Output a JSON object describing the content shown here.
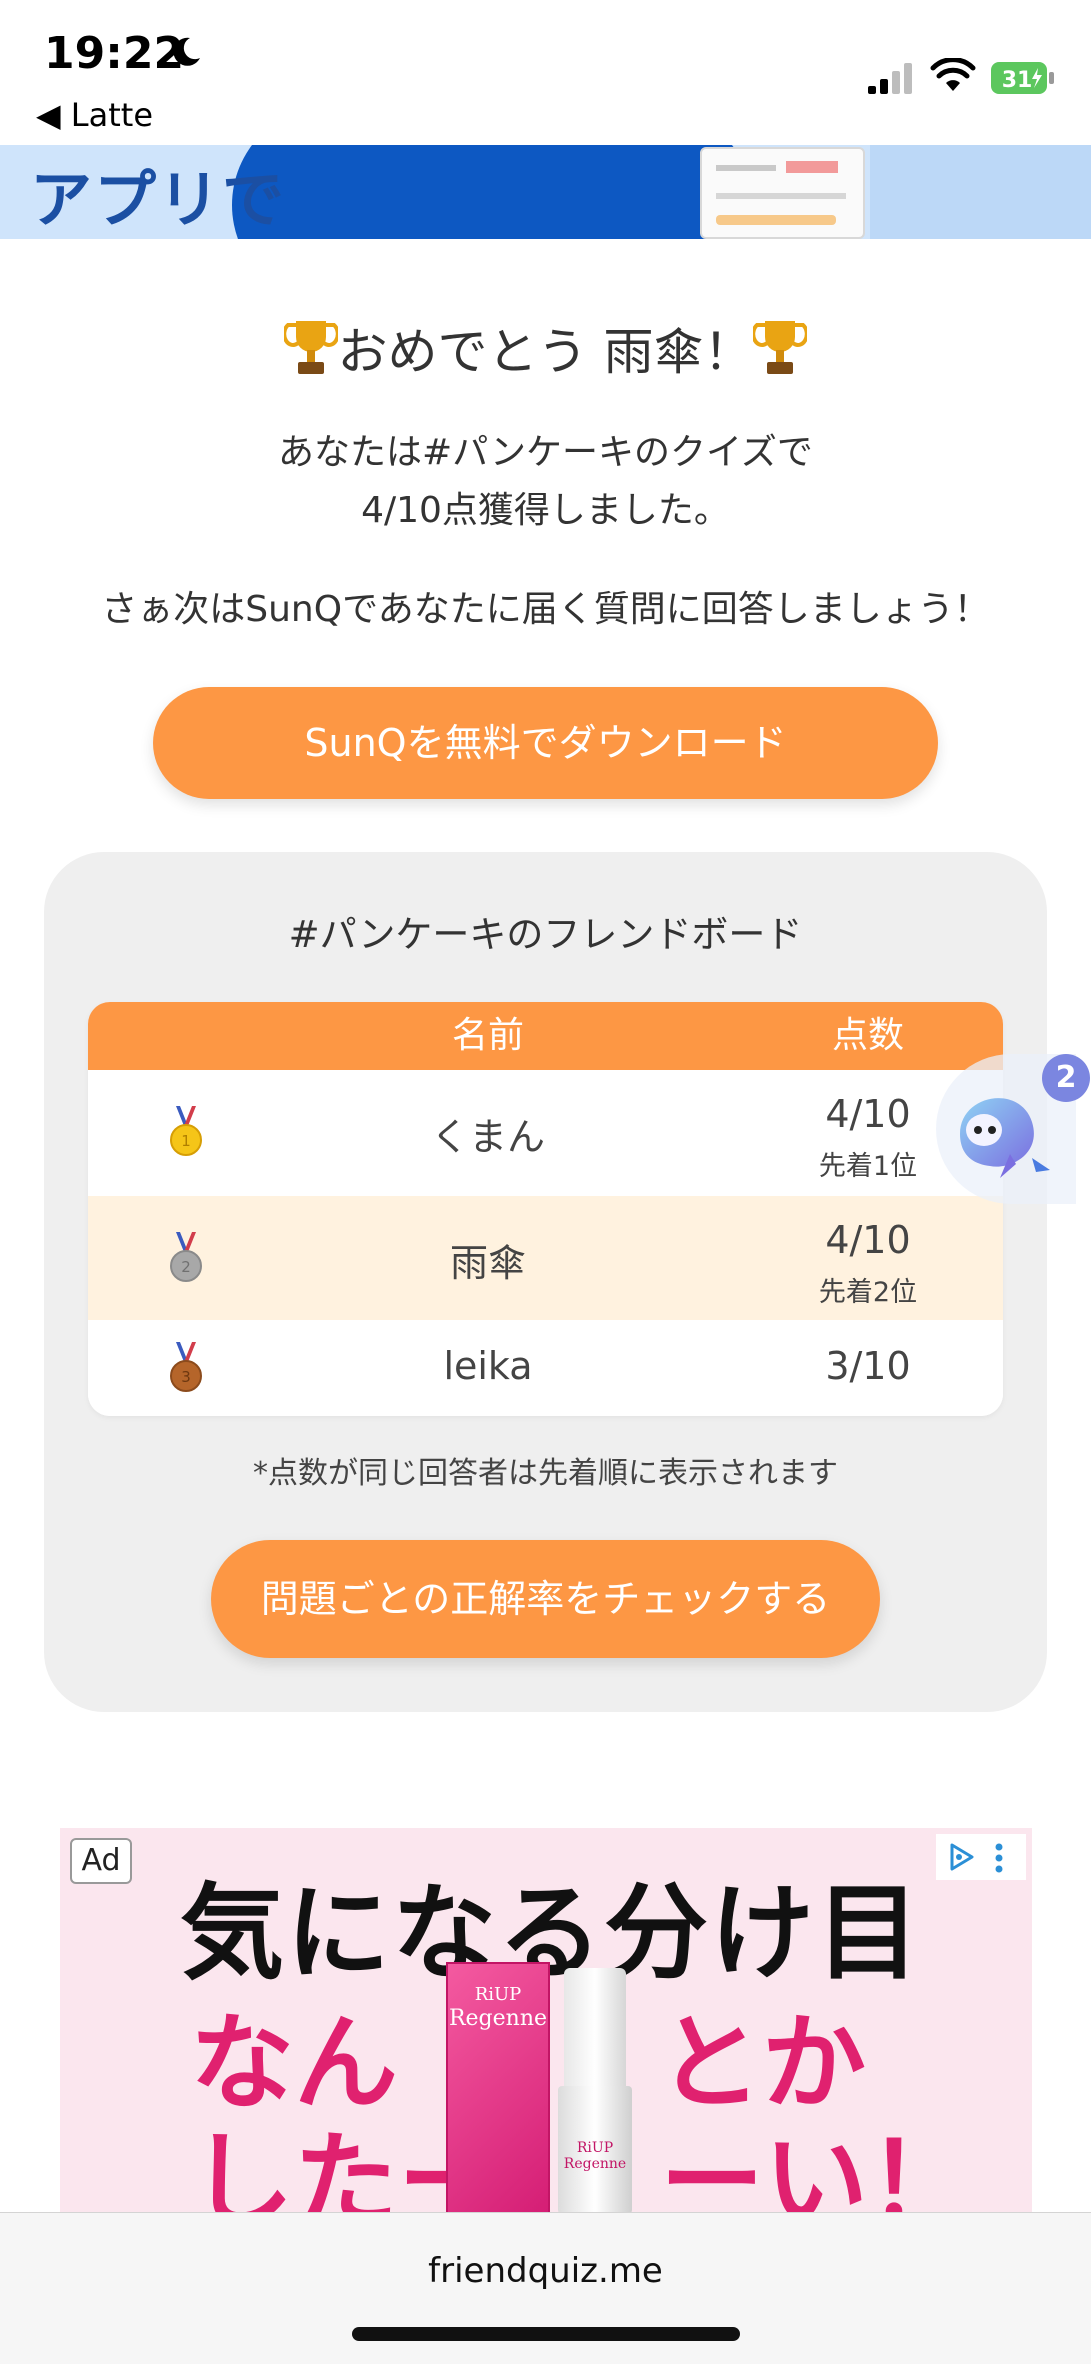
{
  "status_bar": {
    "time": "19:22",
    "back_app": "◀ Latte",
    "battery": "31"
  },
  "banner": {
    "text": "アプリで"
  },
  "congrats": {
    "title": "おめでとう 雨傘！",
    "result_line1": "あなたは#パンケーキのクイズで",
    "result_line2": "4/10点獲得しました。",
    "next_text": "さぁ次はSunQであなたに届く質問に回答しましょう！",
    "download_button": "SunQを無料でダウンロード"
  },
  "board": {
    "title": "#パンケーキのフレンドボード",
    "columns": [
      "名前",
      "点数"
    ],
    "rows": [
      {
        "rank": 1,
        "name": "くまん",
        "score": "4/10",
        "sub": "先着1位",
        "medal_color": "#f5c518"
      },
      {
        "rank": 2,
        "name": "雨傘",
        "score": "4/10",
        "sub": "先着2位",
        "medal_color": "#a8a8a8"
      },
      {
        "rank": 3,
        "name": "leika",
        "score": "3/10",
        "sub": "",
        "medal_color": "#b5652a"
      }
    ],
    "note": "*点数が同じ回答者は先着順に表示されます",
    "check_button": "問題ごとの正解率をチェックする"
  },
  "mascot": {
    "badge_count": "2"
  },
  "ad": {
    "label": "Ad",
    "line1": "気になる分け目",
    "line2a": "なん",
    "line2b": "とか",
    "line3a": "したー",
    "line3b": "ーい！",
    "box_brand": "RiUP",
    "box_name": "Regenne",
    "bottle_label": "RiUP Regenne"
  },
  "url_bar": {
    "url": "friendquiz.me"
  },
  "colors": {
    "accent": "#fd9744",
    "highlight_row": "#fff2df",
    "board_bg": "#efefef",
    "ad_pink": "#e0216f"
  }
}
